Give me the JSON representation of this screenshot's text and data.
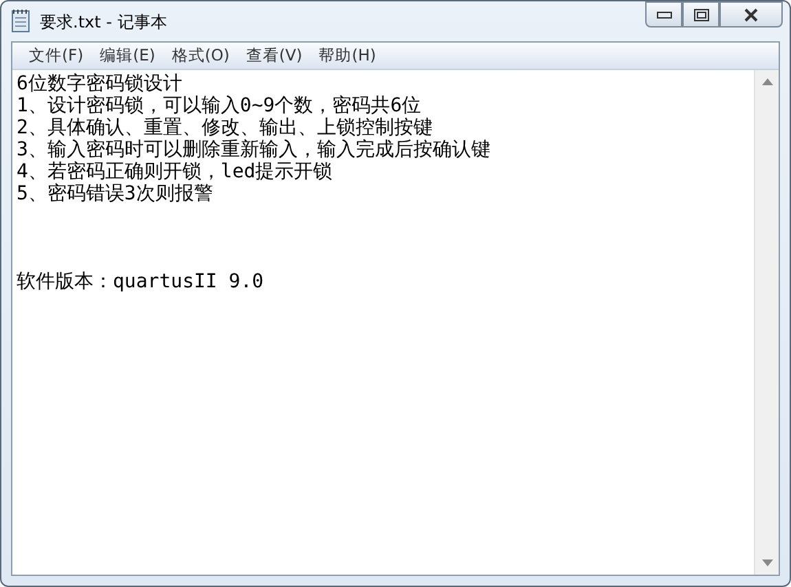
{
  "window": {
    "title": "要求.txt - 记事本"
  },
  "menu": [
    "文件(F)",
    "编辑(E)",
    "格式(O)",
    "查看(V)",
    "帮助(H)"
  ],
  "document": {
    "paragraphs": [
      {
        "lines": [
          "6位数字密码锁设计",
          "1、设计密码锁，可以输入0~9个数，密码共6位",
          "2、具体确认、重置、修改、输出、上锁控制按键",
          "3、输入密码时可以删除重新输入，输入完成后按确认键",
          "4、若密码正确则开锁，led提示开锁",
          "5、密码错误3次则报警"
        ]
      },
      {
        "lines": [
          "软件版本：quartusII 9.0"
        ]
      }
    ]
  }
}
